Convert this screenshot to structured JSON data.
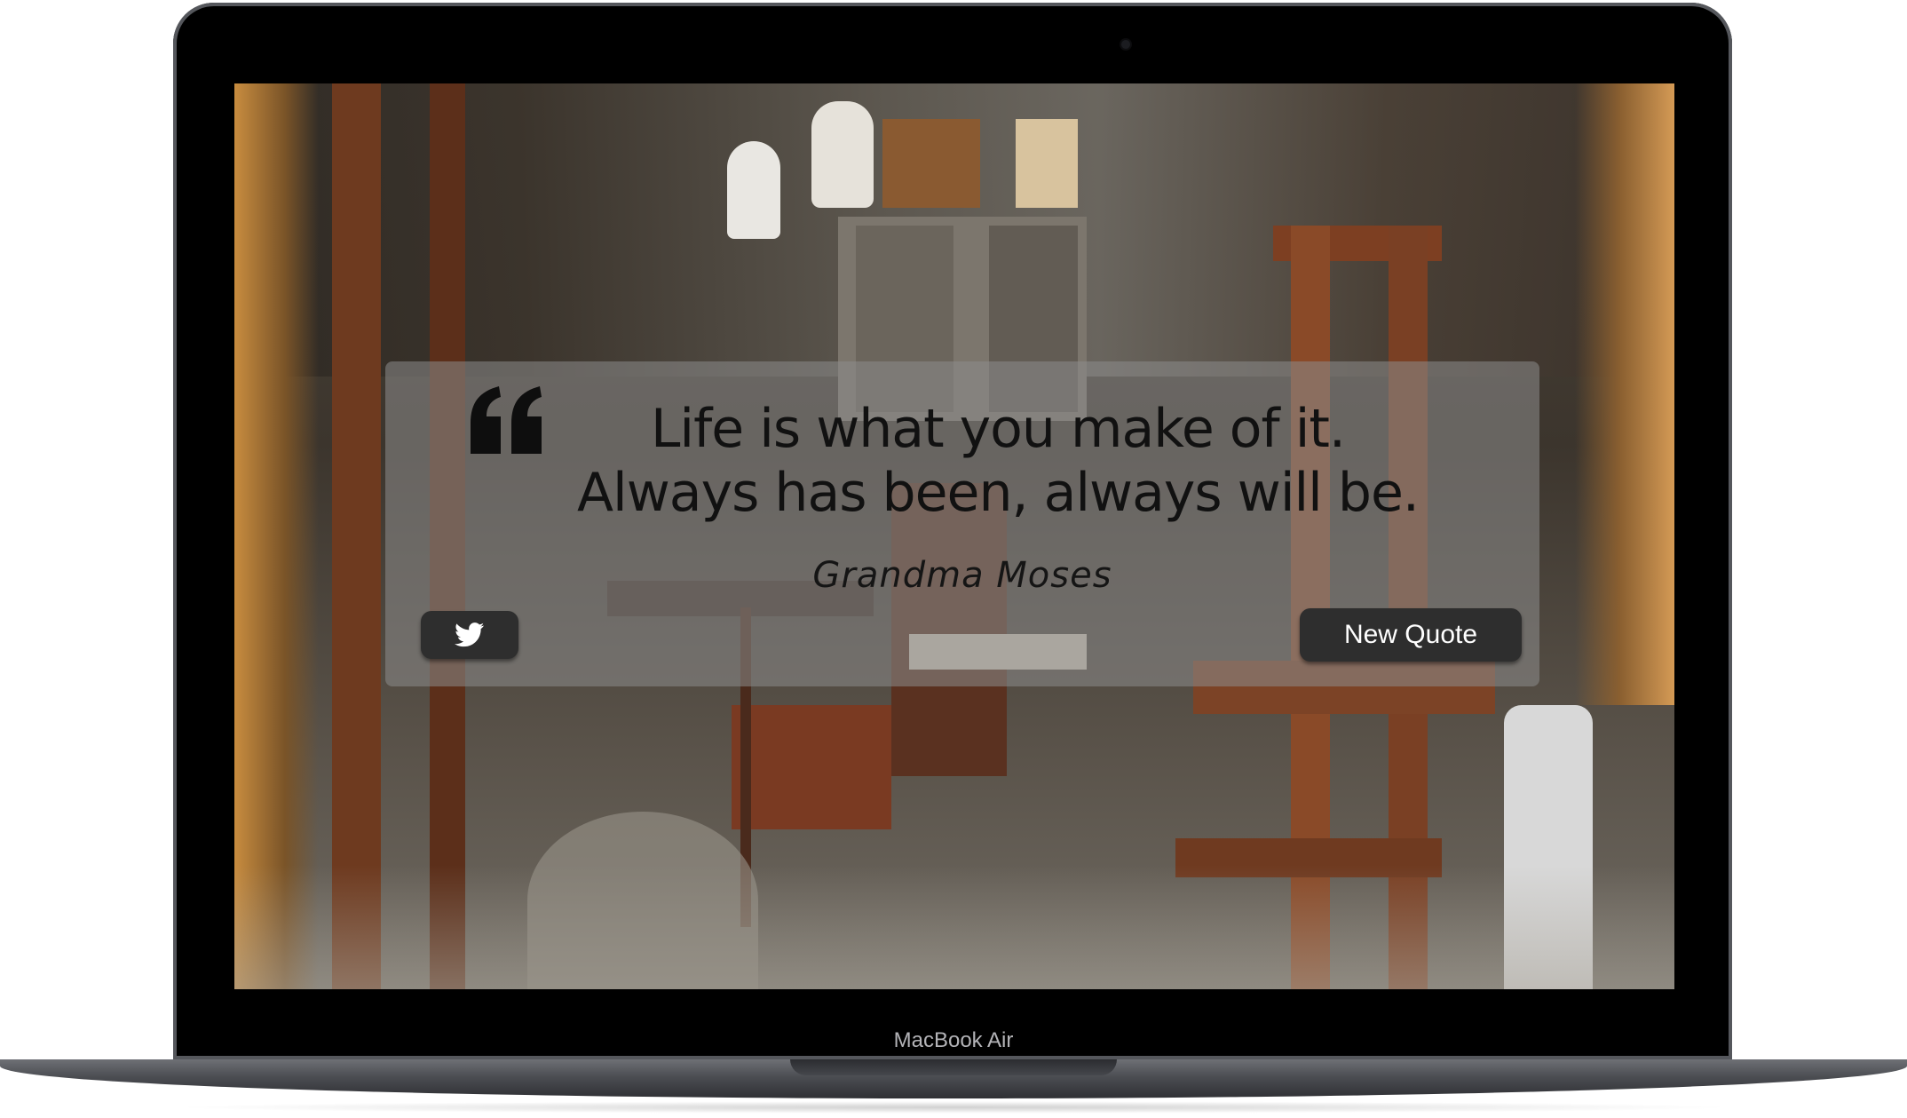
{
  "device": {
    "label": "MacBook Air"
  },
  "quote": {
    "text": "Life is what you make of it. Always has been, always will be.",
    "author": "Grandma Moses"
  },
  "buttons": {
    "tweet_icon": "twitter-icon",
    "new_quote_label": "New Quote"
  },
  "colors": {
    "card_background": "rgba(140,140,140,0.55)",
    "button_background": "#2e2e2e",
    "button_text": "#ffffff",
    "quote_text": "#111111"
  }
}
